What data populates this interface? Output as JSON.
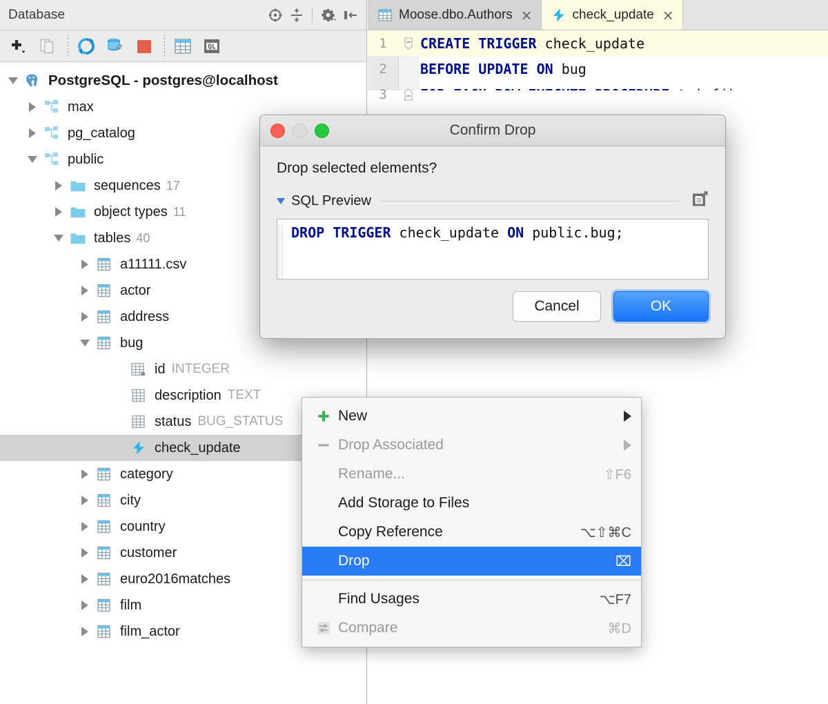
{
  "panel": {
    "title": "Database",
    "header_icons": [
      {
        "name": "locate-icon"
      },
      {
        "name": "expand-collapse-icon"
      },
      {
        "name": "settings-gear-icon"
      },
      {
        "name": "hide-panel-icon"
      }
    ],
    "toolbar_icons": [
      {
        "name": "add-icon"
      },
      {
        "name": "duplicate-icon"
      },
      {
        "name": "synchronize-icon"
      },
      {
        "name": "data-source-properties-icon"
      },
      {
        "name": "stop-icon"
      },
      {
        "name": "open-table-editor-icon"
      },
      {
        "name": "open-query-console-icon"
      }
    ]
  },
  "tree": {
    "root": {
      "label": "PostgreSQL - postgres@localhost",
      "icon": "postgresql-elephant-icon",
      "expanded": true
    },
    "nodes": [
      {
        "label": "max",
        "icon": "schema-icon",
        "indent": 1,
        "state": "collapsed"
      },
      {
        "label": "pg_catalog",
        "icon": "schema-icon",
        "indent": 1,
        "state": "collapsed"
      },
      {
        "label": "public",
        "icon": "schema-icon",
        "indent": 1,
        "state": "expanded"
      },
      {
        "label": "sequences",
        "icon": "folder-icon",
        "indent": 2,
        "state": "collapsed",
        "count": "17"
      },
      {
        "label": "object types",
        "icon": "folder-icon",
        "indent": 2,
        "state": "collapsed",
        "count": "11"
      },
      {
        "label": "tables",
        "icon": "folder-icon",
        "indent": 2,
        "state": "expanded",
        "count": "40"
      },
      {
        "label": "a11111.csv",
        "icon": "table-icon",
        "indent": 3,
        "state": "collapsed"
      },
      {
        "label": "actor",
        "icon": "table-icon",
        "indent": 3,
        "state": "collapsed"
      },
      {
        "label": "address",
        "icon": "table-icon",
        "indent": 3,
        "state": "collapsed"
      },
      {
        "label": "bug",
        "icon": "table-icon",
        "indent": 3,
        "state": "expanded"
      },
      {
        "label": "id",
        "icon": "column-key-icon",
        "indent": 4,
        "state": "leaf",
        "type": "INTEGER"
      },
      {
        "label": "description",
        "icon": "column-icon",
        "indent": 4,
        "state": "leaf",
        "type": "TEXT"
      },
      {
        "label": "status",
        "icon": "column-icon",
        "indent": 4,
        "state": "leaf",
        "type": "BUG_STATUS"
      },
      {
        "label": "check_update",
        "icon": "trigger-bolt-icon",
        "indent": 4,
        "state": "leaf",
        "selected": true
      },
      {
        "label": "category",
        "icon": "table-icon",
        "indent": 3,
        "state": "collapsed"
      },
      {
        "label": "city",
        "icon": "table-icon",
        "indent": 3,
        "state": "collapsed"
      },
      {
        "label": "country",
        "icon": "table-icon",
        "indent": 3,
        "state": "collapsed"
      },
      {
        "label": "customer",
        "icon": "table-icon",
        "indent": 3,
        "state": "collapsed"
      },
      {
        "label": "euro2016matches",
        "icon": "table-icon",
        "indent": 3,
        "state": "collapsed"
      },
      {
        "label": "film",
        "icon": "table-icon",
        "indent": 3,
        "state": "collapsed"
      },
      {
        "label": "film_actor",
        "icon": "table-icon",
        "indent": 3,
        "state": "collapsed"
      }
    ]
  },
  "editor": {
    "tabs": [
      {
        "label": "Moose.dbo.Authors",
        "icon": "table-icon",
        "active": false,
        "close": "×"
      },
      {
        "label": "check_update",
        "icon": "trigger-bolt-icon",
        "active": true,
        "close": "×"
      }
    ],
    "lines": [
      {
        "no": "1",
        "fold": "minus",
        "highlight": true,
        "parts": [
          {
            "t": "CREATE TRIGGER",
            "kw": true
          },
          {
            "t": " check_update",
            "kw": false
          }
        ]
      },
      {
        "no": "2",
        "fold": "none",
        "highlight": false,
        "parts": [
          {
            "t": "BEFORE UPDATE ON",
            "kw": true
          },
          {
            "t": " bug",
            "kw": false
          }
        ]
      },
      {
        "no": "3",
        "fold": "minus-end",
        "highlight": false,
        "parts": [
          {
            "t": "FOR EACH ROW EXECUTE PROCEDURE",
            "kw": true
          },
          {
            "t": " trigf()",
            "kw": false
          }
        ]
      }
    ]
  },
  "context_menu": {
    "items": [
      {
        "label": "New",
        "icon": "plus-green-icon",
        "submenu": true,
        "enabled": true
      },
      {
        "label": "Drop Associated",
        "icon": "minus-icon",
        "submenu": true,
        "enabled": false
      },
      {
        "label": "Rename...",
        "icon": null,
        "shortcut": "⇧F6",
        "enabled": false
      },
      {
        "label": "Add Storage to Files",
        "icon": null,
        "shortcut": "",
        "enabled": true
      },
      {
        "label": "Copy Reference",
        "icon": null,
        "shortcut": "⌥⇧⌘C",
        "enabled": true
      },
      {
        "label": "Drop",
        "icon": null,
        "shortcut": "⌧",
        "enabled": true,
        "selected": true
      },
      {
        "separator": true
      },
      {
        "label": "Find Usages",
        "icon": null,
        "shortcut": "⌥F7",
        "enabled": true
      },
      {
        "label": "Compare",
        "icon": "compare-icon",
        "shortcut": "⌘D",
        "enabled": false
      }
    ]
  },
  "dialog": {
    "title": "Confirm Drop",
    "question": "Drop selected elements?",
    "sql_preview_label": "SQL Preview",
    "expand_icon": "open-in-editor-icon",
    "sql_parts": [
      {
        "t": "DROP TRIGGER",
        "kw": true
      },
      {
        "t": " check_update ",
        "kw": false
      },
      {
        "t": "ON",
        "kw": true
      },
      {
        "t": " public.bug;",
        "kw": false
      }
    ],
    "buttons": {
      "cancel": "Cancel",
      "ok": "OK"
    },
    "traffic": {
      "close": "close-button",
      "minimize": "minimize-button",
      "zoom": "zoom-button"
    }
  },
  "colors": {
    "accent_blue": "#2a7bf6",
    "keyword_blue": "#00108a",
    "active_tab_bg": "#fdfbe2",
    "selection_gray": "#d2d2d2",
    "ok_button_blue": "#1674f5"
  }
}
